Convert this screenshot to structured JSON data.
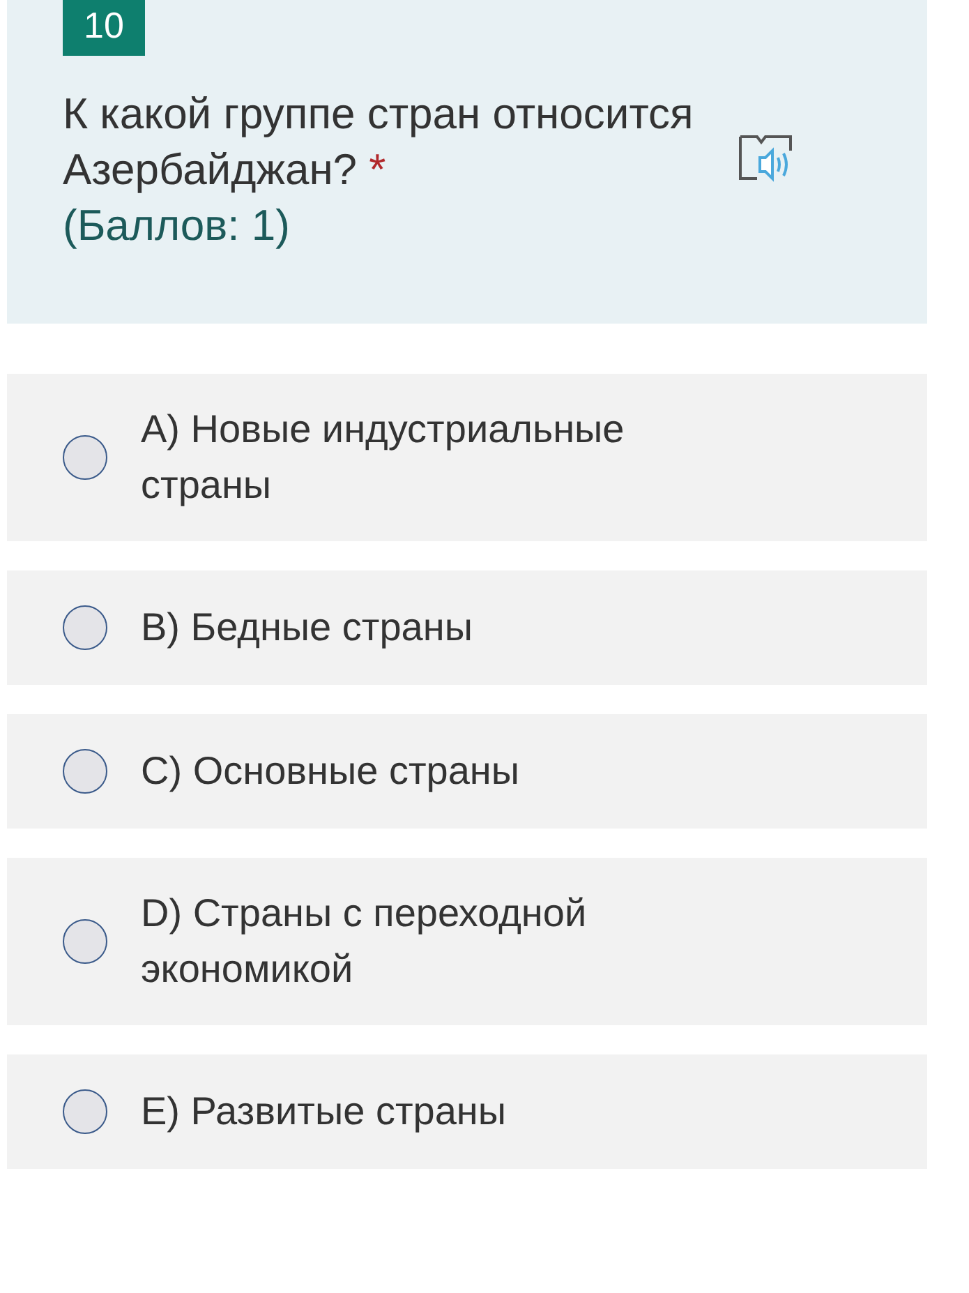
{
  "question": {
    "number": "10",
    "text": "К какой группе стран относится Азербайджан?",
    "required_mark": "*",
    "points": "(Баллов: 1)"
  },
  "options": [
    {
      "label": "A) Новые индустриальные страны",
      "selected": false
    },
    {
      "label": "B) Бедные страны",
      "selected": false
    },
    {
      "label": "C) Основные страны",
      "selected": false
    },
    {
      "label": "D) Страны с переходной экономикой",
      "selected": false
    },
    {
      "label": "E) Развитые страны",
      "selected": false
    }
  ]
}
